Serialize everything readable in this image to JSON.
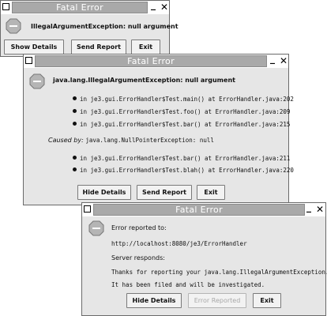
{
  "window1": {
    "title": "Fatal Error",
    "minimize": "_",
    "close": "✕",
    "message": "IllegalArgumentException: null argument",
    "buttons": {
      "show_details": "Show Details",
      "send_report": "Send Report",
      "exit": "Exit"
    }
  },
  "window2": {
    "title": "Fatal Error",
    "minimize": "_",
    "close": "✕",
    "message": "java.lang.IllegalArgumentException: null argument",
    "stack1": [
      "in je3.gui.ErrorHandler$Test.main() at ErrorHandler.java:202",
      "in je3.gui.ErrorHandler$Test.foo() at ErrorHandler.java:209",
      "in je3.gui.ErrorHandler$Test.bar() at ErrorHandler.java:215"
    ],
    "caused_by_label": "Caused by:",
    "caused_by_text": "java.lang.NullPointerException: null",
    "stack2": [
      "in je3.gui.ErrorHandler$Test.bar() at ErrorHandler.java:211",
      "in je3.gui.ErrorHandler$Test.blah() at ErrorHandler.java:220"
    ],
    "buttons": {
      "hide_details": "Hide Details",
      "send_report": "Send Report",
      "exit": "Exit"
    }
  },
  "window3": {
    "title": "Fatal Error",
    "minimize": "_",
    "close": "✕",
    "reported_to_label": "Error reported to:",
    "url": "http://localhost:8080/je3/ErrorHandler",
    "server_label": "Server responds:",
    "response_line1": "Thanks for reporting your java.lang.IllegalArgumentException.",
    "response_line2": "It has been filed and will be investigated.",
    "buttons": {
      "hide_details": "Hide Details",
      "error_reported": "Error Reported",
      "exit": "Exit"
    }
  },
  "colors": {
    "titlebar": "#a9a9a9",
    "window_bg": "#e6e6e6",
    "stop_icon": "#b0b0b0"
  },
  "icons": {
    "error": "stop-sign-icon"
  }
}
